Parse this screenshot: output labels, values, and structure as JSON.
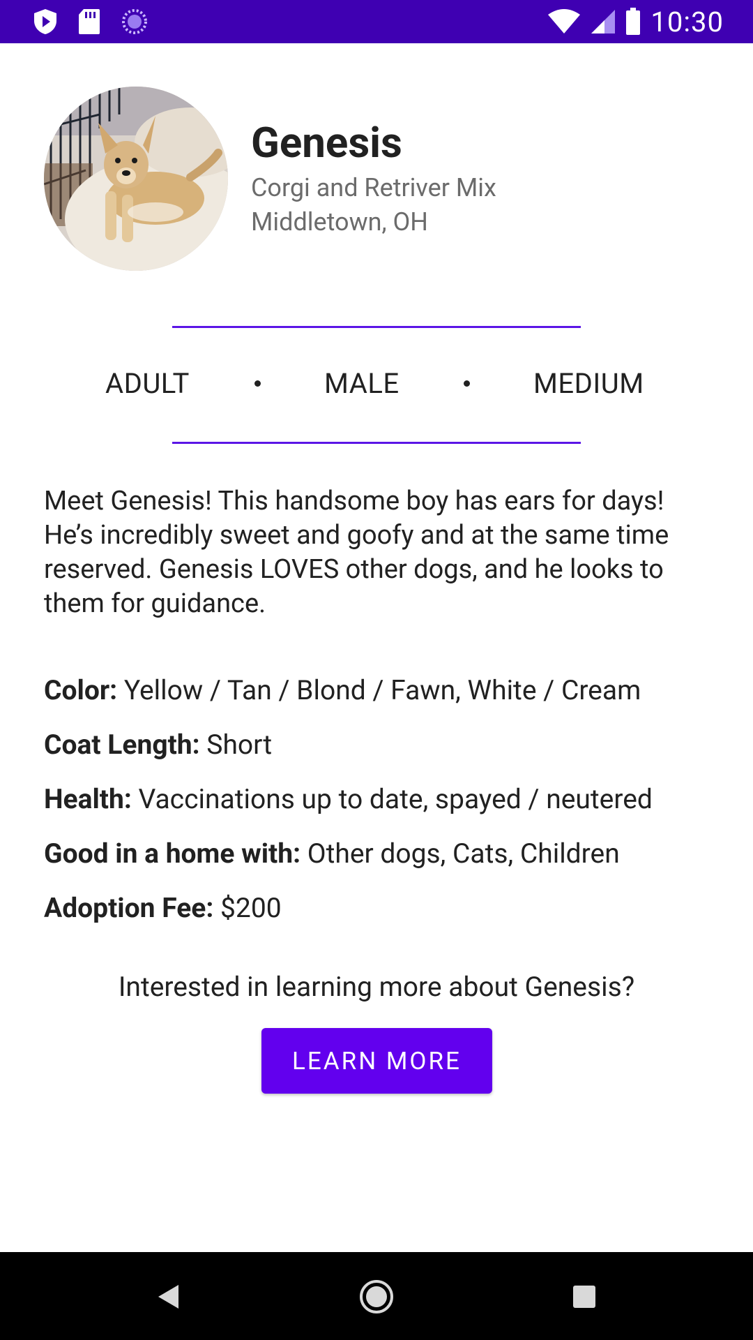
{
  "status_bar": {
    "time": "10:30",
    "left_icons": [
      "play-protect-icon",
      "sd-card-icon",
      "sync-icon"
    ],
    "right_icons": [
      "wifi-icon",
      "signal-icon",
      "battery-icon"
    ],
    "background": "#3f00b2"
  },
  "pet": {
    "name": "Genesis",
    "breed": "Corgi and Retriver Mix",
    "location": "Middletown, OH",
    "photo_icon": "dog-photo",
    "attributes": [
      "ADULT",
      "MALE",
      "MEDIUM"
    ],
    "description": "Meet Genesis! This handsome boy has ears for days! He’s incredibly sweet and goofy and at the same time reserved. Genesis LOVES other dogs, and he looks to them for guidance."
  },
  "details": [
    {
      "label": "Color:",
      "value": " Yellow / Tan / Blond / Fawn, White / Cream"
    },
    {
      "label": "Coat Length:",
      "value": " Short"
    },
    {
      "label": "Health:",
      "value": " Vaccinations up to date, spayed / neutered"
    },
    {
      "label": "Good in a home with:",
      "value": " Other dogs, Cats, Children"
    },
    {
      "label": "Adoption Fee:",
      "value": " $200"
    }
  ],
  "cta": {
    "prompt": "Interested in learning more about Genesis?",
    "button_label": "LEARN MORE",
    "button_color": "#6200ee",
    "divider_color": "#5b15e6"
  },
  "nav_bar": {
    "icons": [
      "back-icon",
      "home-icon",
      "recents-icon"
    ]
  }
}
